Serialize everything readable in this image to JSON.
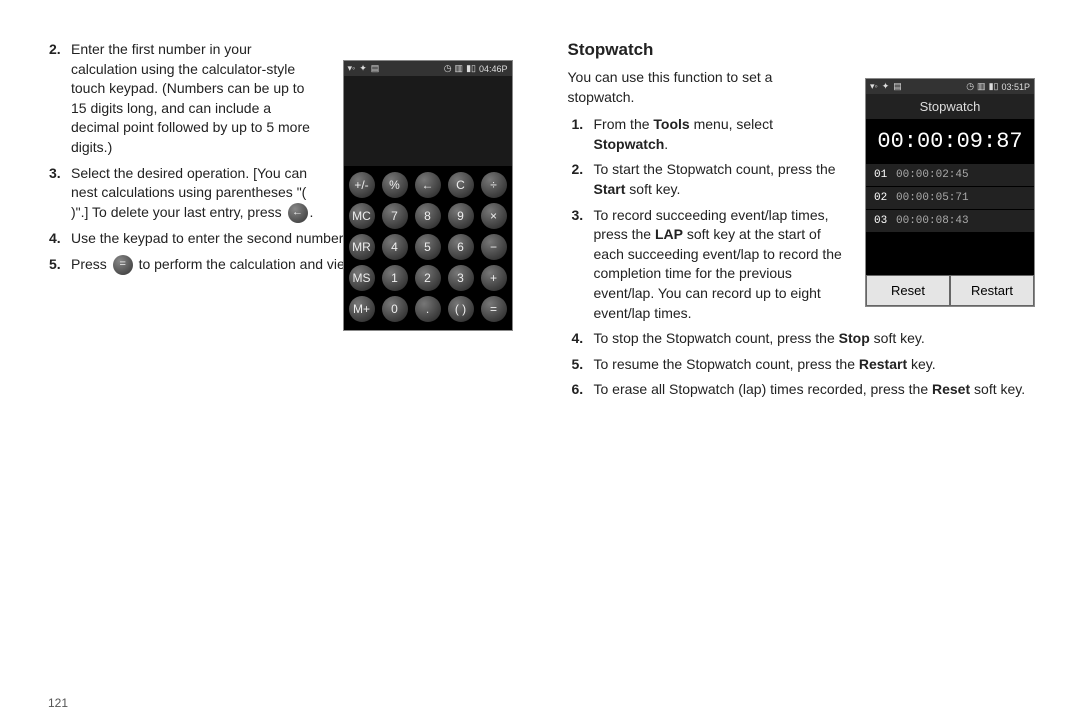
{
  "page_number": "121",
  "left": {
    "steps": [
      {
        "n": "2.",
        "text_a": "Enter the first number in your calculation using the calculator-style touch keypad. (Numbers can be up to 15 digits long, and can include a decimal point followed by up to 5 more digits.)"
      },
      {
        "n": "3.",
        "text_a": "Select the desired operation. [You can nest calculations using parentheses \"( )\".] To delete your last entry, press ",
        "icon_after": "←",
        "text_b": "."
      },
      {
        "n": "4.",
        "text_a": "Use the keypad to enter the second number for your calculation."
      },
      {
        "n": "5.",
        "text_a": "Press ",
        "icon_after": "=",
        "text_b": " to perform the calculation and view the result."
      }
    ]
  },
  "calc": {
    "time": "04:46P",
    "rows": [
      [
        "+/-",
        "%",
        "←",
        "C",
        "÷"
      ],
      [
        "MC",
        "7",
        "8",
        "9",
        "×"
      ],
      [
        "MR",
        "4",
        "5",
        "6",
        "−"
      ],
      [
        "MS",
        "1",
        "2",
        "3",
        "+"
      ],
      [
        "M+",
        "0",
        ".",
        "( )",
        "="
      ]
    ]
  },
  "right": {
    "heading": "Stopwatch",
    "intro": "You can use this function to set a stopwatch.",
    "steps": [
      {
        "n": "1.",
        "parts": [
          "From the ",
          "Tools",
          " menu, select ",
          "Stopwatch",
          "."
        ]
      },
      {
        "n": "2.",
        "parts": [
          "To start the Stopwatch count, press the ",
          "Start",
          " soft key."
        ]
      },
      {
        "n": "3.",
        "parts": [
          "To record succeeding event/lap times, press the ",
          "LAP",
          " soft key at the start of each succeeding event/lap to record the completion time for the previous event/lap. You can record up to eight event/lap times."
        ]
      },
      {
        "n": "4.",
        "parts": [
          "To stop the Stopwatch count, press the ",
          "Stop",
          " soft key."
        ]
      },
      {
        "n": "5.",
        "parts": [
          "To resume the Stopwatch count, press the ",
          "Restart",
          " key."
        ]
      },
      {
        "n": "6.",
        "parts": [
          "To erase all Stopwatch (lap) times recorded, press the ",
          "Reset",
          " soft key."
        ]
      }
    ]
  },
  "stopwatch": {
    "time": "03:51P",
    "title": "Stopwatch",
    "main": "00:00:09:87",
    "laps": [
      {
        "no": "01",
        "t": "00:00:02:45"
      },
      {
        "no": "02",
        "t": "00:00:05:71"
      },
      {
        "no": "03",
        "t": "00:00:08:43"
      }
    ],
    "reset": "Reset",
    "restart": "Restart"
  }
}
